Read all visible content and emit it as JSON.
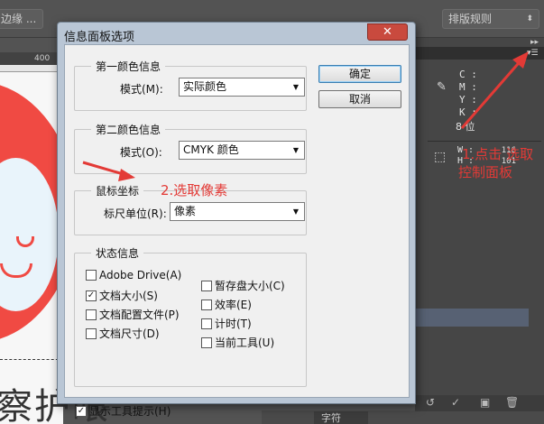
{
  "background": {
    "top_left_button": "边缘 ...",
    "top_right_button": "排版规则",
    "ruler_tick": "400",
    "canvas_text": "察护眼",
    "info_panel": {
      "cmyk_labels": [
        "C :",
        "M :",
        "Y :",
        "K :"
      ],
      "bit_depth": "8 位",
      "w_label": "W :",
      "h_label": "H :",
      "w_value": "116",
      "h_value": "101"
    },
    "bottom_tab": "字符",
    "colors": {
      "app_bg": "#535353",
      "logo_red": "#f04a43",
      "annotation_red": "#e33a36"
    }
  },
  "annotations": {
    "step1_line1": "1.点击 选取",
    "step1_line2": "控制面板",
    "step2": "2.选取像素"
  },
  "dialog": {
    "title": "信息面板选项",
    "close_glyph": "✕",
    "ok_label": "确定",
    "cancel_label": "取消",
    "first_color": {
      "legend": "第一颜色信息",
      "mode_label": "模式(M):",
      "mode_value": "实际颜色"
    },
    "second_color": {
      "legend": "第二颜色信息",
      "mode_label": "模式(O):",
      "mode_value": "CMYK 颜色"
    },
    "mouse_coords": {
      "legend": "鼠标坐标",
      "ruler_label": "标尺单位(R):",
      "ruler_value": "像素"
    },
    "status": {
      "legend": "状态信息",
      "left": [
        {
          "label": "Adobe Drive(A)",
          "checked": false
        },
        {
          "label": "文档大小(S)",
          "checked": true
        },
        {
          "label": "文档配置文件(P)",
          "checked": false
        },
        {
          "label": "文档尺寸(D)",
          "checked": false
        }
      ],
      "right": [
        {
          "label": "暂存盘大小(C)",
          "checked": false
        },
        {
          "label": "效率(E)",
          "checked": false
        },
        {
          "label": "计时(T)",
          "checked": false
        },
        {
          "label": "当前工具(U)",
          "checked": false
        }
      ]
    },
    "show_tooltips": {
      "label": "显示工具提示(H)",
      "checked": true
    }
  }
}
